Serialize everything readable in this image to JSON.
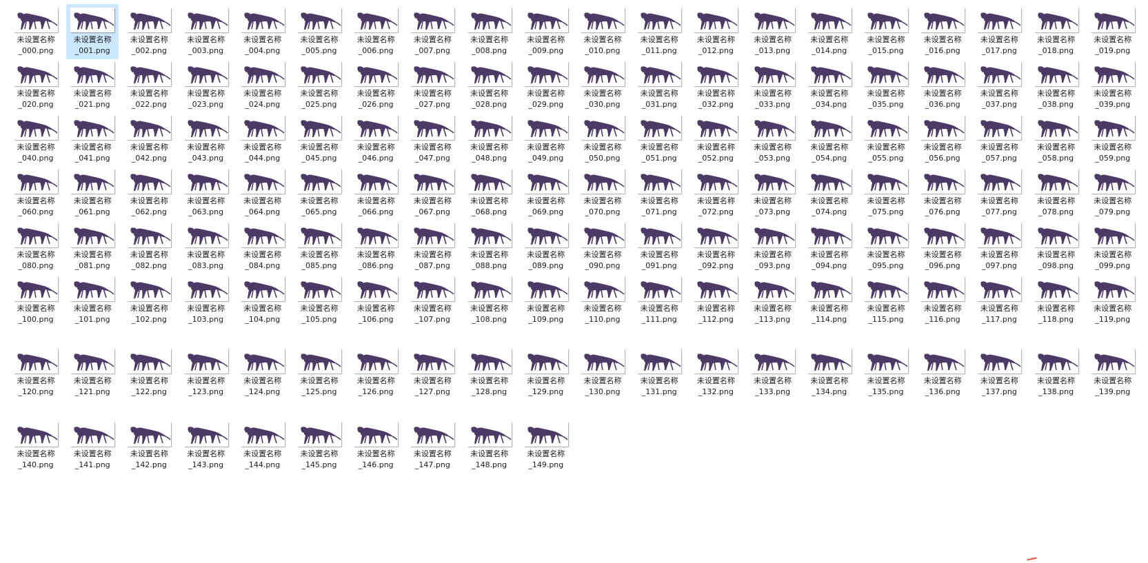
{
  "view": {
    "icon": "creature-thumbnail",
    "thumbnail_tint": "#4b3a66",
    "selection_color": "#cce8ff",
    "selected_index": 1,
    "row_sizes": [
      20,
      20,
      20,
      20,
      20,
      20,
      20,
      10
    ]
  },
  "files": [
    {
      "name": "未设置名称\n_000.png"
    },
    {
      "name": "未设置名称\n_001.png"
    },
    {
      "name": "未设置名称\n_002.png"
    },
    {
      "name": "未设置名称\n_003.png"
    },
    {
      "name": "未设置名称\n_004.png"
    },
    {
      "name": "未设置名称\n_005.png"
    },
    {
      "name": "未设置名称\n_006.png"
    },
    {
      "name": "未设置名称\n_007.png"
    },
    {
      "name": "未设置名称\n_008.png"
    },
    {
      "name": "未设置名称\n_009.png"
    },
    {
      "name": "未设置名称\n_010.png"
    },
    {
      "name": "未设置名称\n_011.png"
    },
    {
      "name": "未设置名称\n_012.png"
    },
    {
      "name": "未设置名称\n_013.png"
    },
    {
      "name": "未设置名称\n_014.png"
    },
    {
      "name": "未设置名称\n_015.png"
    },
    {
      "name": "未设置名称\n_016.png"
    },
    {
      "name": "未设置名称\n_017.png"
    },
    {
      "name": "未设置名称\n_018.png"
    },
    {
      "name": "未设置名称\n_019.png"
    },
    {
      "name": "未设置名称\n_020.png"
    },
    {
      "name": "未设置名称\n_021.png"
    },
    {
      "name": "未设置名称\n_022.png"
    },
    {
      "name": "未设置名称\n_023.png"
    },
    {
      "name": "未设置名称\n_024.png"
    },
    {
      "name": "未设置名称\n_025.png"
    },
    {
      "name": "未设置名称\n_026.png"
    },
    {
      "name": "未设置名称\n_027.png"
    },
    {
      "name": "未设置名称\n_028.png"
    },
    {
      "name": "未设置名称\n_029.png"
    },
    {
      "name": "未设置名称\n_030.png"
    },
    {
      "name": "未设置名称\n_031.png"
    },
    {
      "name": "未设置名称\n_032.png"
    },
    {
      "name": "未设置名称\n_033.png"
    },
    {
      "name": "未设置名称\n_034.png"
    },
    {
      "name": "未设置名称\n_035.png"
    },
    {
      "name": "未设置名称\n_036.png"
    },
    {
      "name": "未设置名称\n_037.png"
    },
    {
      "name": "未设置名称\n_038.png"
    },
    {
      "name": "未设置名称\n_039.png"
    },
    {
      "name": "未设置名称\n_040.png"
    },
    {
      "name": "未设置名称\n_041.png"
    },
    {
      "name": "未设置名称\n_042.png"
    },
    {
      "name": "未设置名称\n_043.png"
    },
    {
      "name": "未设置名称\n_044.png"
    },
    {
      "name": "未设置名称\n_045.png"
    },
    {
      "name": "未设置名称\n_046.png"
    },
    {
      "name": "未设置名称\n_047.png"
    },
    {
      "name": "未设置名称\n_048.png"
    },
    {
      "name": "未设置名称\n_049.png"
    },
    {
      "name": "未设置名称\n_050.png"
    },
    {
      "name": "未设置名称\n_051.png"
    },
    {
      "name": "未设置名称\n_052.png"
    },
    {
      "name": "未设置名称\n_053.png"
    },
    {
      "name": "未设置名称\n_054.png"
    },
    {
      "name": "未设置名称\n_055.png"
    },
    {
      "name": "未设置名称\n_056.png"
    },
    {
      "name": "未设置名称\n_057.png"
    },
    {
      "name": "未设置名称\n_058.png"
    },
    {
      "name": "未设置名称\n_059.png"
    },
    {
      "name": "未设置名称\n_060.png"
    },
    {
      "name": "未设置名称\n_061.png"
    },
    {
      "name": "未设置名称\n_062.png"
    },
    {
      "name": "未设置名称\n_063.png"
    },
    {
      "name": "未设置名称\n_064.png"
    },
    {
      "name": "未设置名称\n_065.png"
    },
    {
      "name": "未设置名称\n_066.png"
    },
    {
      "name": "未设置名称\n_067.png"
    },
    {
      "name": "未设置名称\n_068.png"
    },
    {
      "name": "未设置名称\n_069.png"
    },
    {
      "name": "未设置名称\n_070.png"
    },
    {
      "name": "未设置名称\n_071.png"
    },
    {
      "name": "未设置名称\n_072.png"
    },
    {
      "name": "未设置名称\n_073.png"
    },
    {
      "name": "未设置名称\n_074.png"
    },
    {
      "name": "未设置名称\n_075.png"
    },
    {
      "name": "未设置名称\n_076.png"
    },
    {
      "name": "未设置名称\n_077.png"
    },
    {
      "name": "未设置名称\n_078.png"
    },
    {
      "name": "未设置名称\n_079.png"
    },
    {
      "name": "未设置名称\n_080.png"
    },
    {
      "name": "未设置名称\n_081.png"
    },
    {
      "name": "未设置名称\n_082.png"
    },
    {
      "name": "未设置名称\n_083.png"
    },
    {
      "name": "未设置名称\n_084.png"
    },
    {
      "name": "未设置名称\n_085.png"
    },
    {
      "name": "未设置名称\n_086.png"
    },
    {
      "name": "未设置名称\n_087.png"
    },
    {
      "name": "未设置名称\n_088.png"
    },
    {
      "name": "未设置名称\n_089.png"
    },
    {
      "name": "未设置名称\n_090.png"
    },
    {
      "name": "未设置名称\n_091.png"
    },
    {
      "name": "未设置名称\n_092.png"
    },
    {
      "name": "未设置名称\n_093.png"
    },
    {
      "name": "未设置名称\n_094.png"
    },
    {
      "name": "未设置名称\n_095.png"
    },
    {
      "name": "未设置名称\n_096.png"
    },
    {
      "name": "未设置名称\n_097.png"
    },
    {
      "name": "未设置名称\n_098.png"
    },
    {
      "name": "未设置名称\n_099.png"
    },
    {
      "name": "未设置名称\n_100.png"
    },
    {
      "name": "未设置名称\n_101.png"
    },
    {
      "name": "未设置名称\n_102.png"
    },
    {
      "name": "未设置名称\n_103.png"
    },
    {
      "name": "未设置名称\n_104.png"
    },
    {
      "name": "未设置名称\n_105.png"
    },
    {
      "name": "未设置名称\n_106.png"
    },
    {
      "name": "未设置名称\n_107.png"
    },
    {
      "name": "未设置名称\n_108.png"
    },
    {
      "name": "未设置名称\n_109.png"
    },
    {
      "name": "未设置名称\n_110.png"
    },
    {
      "name": "未设置名称\n_111.png"
    },
    {
      "name": "未设置名称\n_112.png"
    },
    {
      "name": "未设置名称\n_113.png"
    },
    {
      "name": "未设置名称\n_114.png"
    },
    {
      "name": "未设置名称\n_115.png"
    },
    {
      "name": "未设置名称\n_116.png"
    },
    {
      "name": "未设置名称\n_117.png"
    },
    {
      "name": "未设置名称\n_118.png"
    },
    {
      "name": "未设置名称\n_119.png"
    },
    {
      "name": "未设置名称\n_120.png"
    },
    {
      "name": "未设置名称\n_121.png"
    },
    {
      "name": "未设置名称\n_122.png"
    },
    {
      "name": "未设置名称\n_123.png"
    },
    {
      "name": "未设置名称\n_124.png"
    },
    {
      "name": "未设置名称\n_125.png"
    },
    {
      "name": "未设置名称\n_126.png"
    },
    {
      "name": "未设置名称\n_127.png"
    },
    {
      "name": "未设置名称\n_128.png"
    },
    {
      "name": "未设置名称\n_129.png"
    },
    {
      "name": "未设置名称\n_130.png"
    },
    {
      "name": "未设置名称\n_131.png"
    },
    {
      "name": "未设置名称\n_132.png"
    },
    {
      "name": "未设置名称\n_133.png"
    },
    {
      "name": "未设置名称\n_134.png"
    },
    {
      "name": "未设置名称\n_135.png"
    },
    {
      "name": "未设置名称\n_136.png"
    },
    {
      "name": "未设置名称\n_137.png"
    },
    {
      "name": "未设置名称\n_138.png"
    },
    {
      "name": "未设置名称\n_139.png"
    },
    {
      "name": "未设置名称\n_140.png"
    },
    {
      "name": "未设置名称\n_141.png"
    },
    {
      "name": "未设置名称\n_142.png"
    },
    {
      "name": "未设置名称\n_143.png"
    },
    {
      "name": "未设置名称\n_144.png"
    },
    {
      "name": "未设置名称\n_145.png"
    },
    {
      "name": "未设置名称\n_146.png"
    },
    {
      "name": "未设置名称\n_147.png"
    },
    {
      "name": "未设置名称\n_148.png"
    },
    {
      "name": "未设置名称\n_149.png"
    }
  ]
}
